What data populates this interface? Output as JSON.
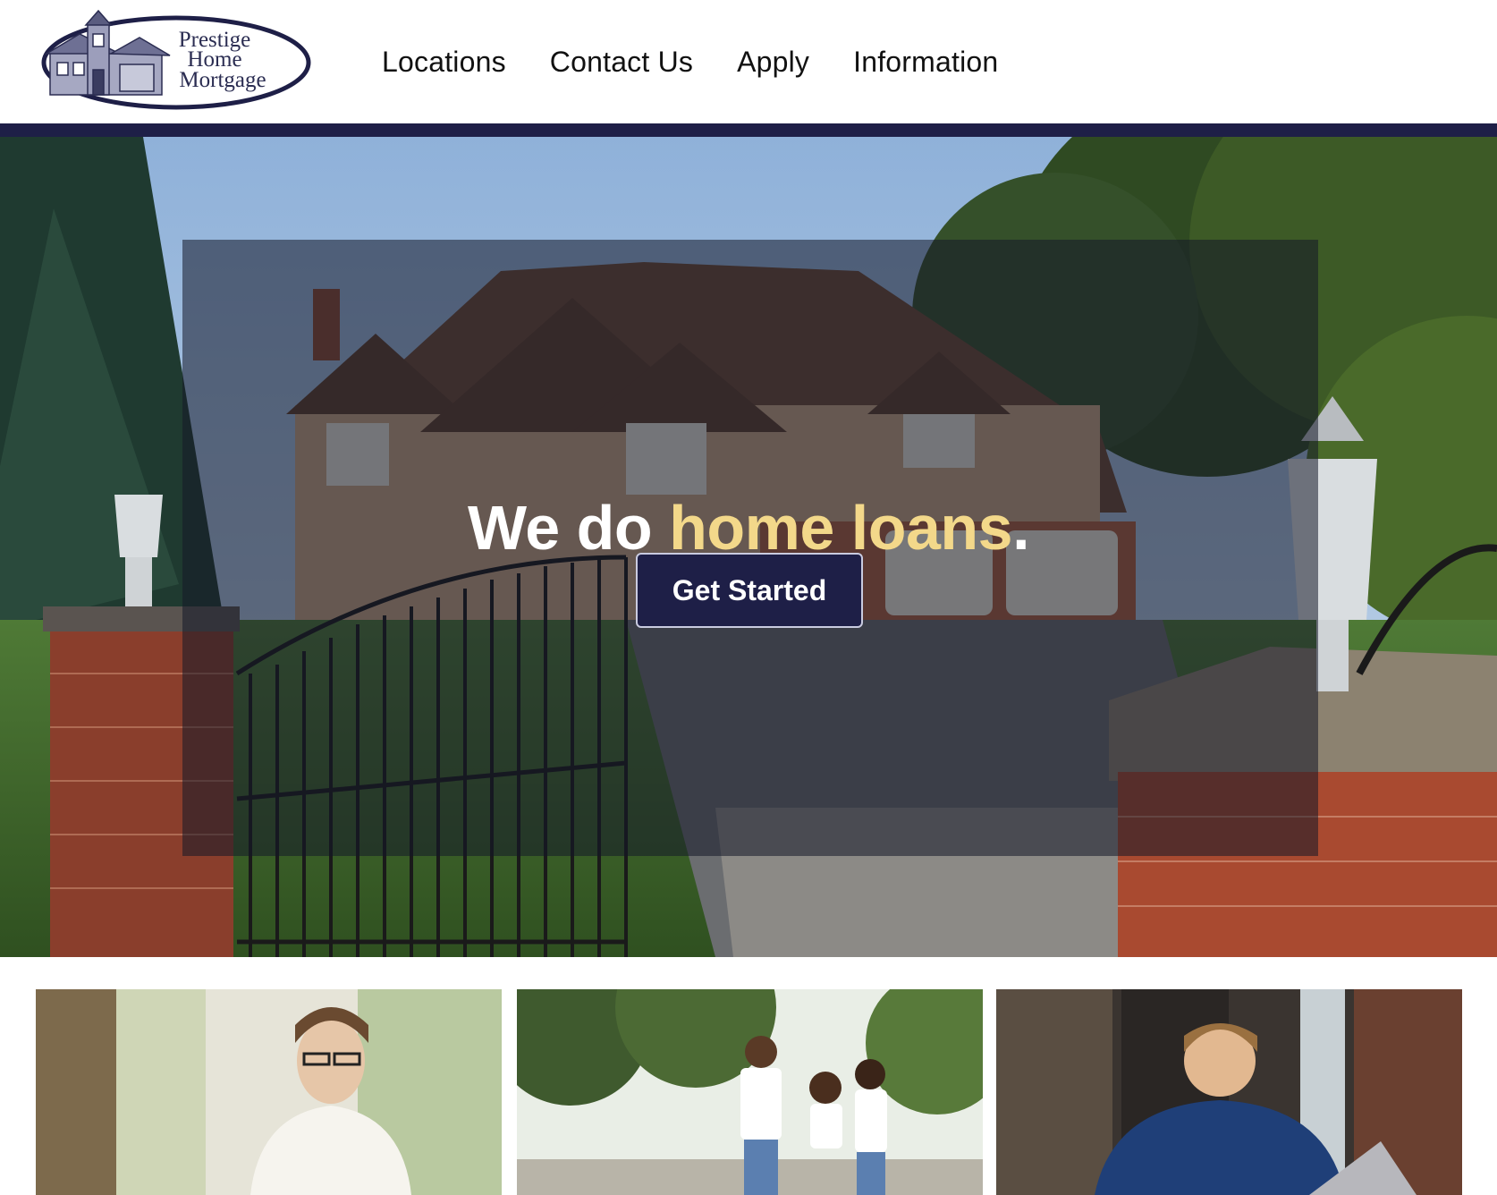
{
  "header": {
    "logo": {
      "lines": [
        "Prestige",
        "Home",
        "Mortgage"
      ],
      "icon": "house-logo-icon"
    },
    "nav": [
      {
        "label": "Locations"
      },
      {
        "label": "Contact Us"
      },
      {
        "label": "Apply"
      },
      {
        "label": "Information"
      }
    ]
  },
  "hero": {
    "headline_prefix": "We do ",
    "headline_accent": "home loans",
    "headline_suffix": ".",
    "cta_label": "Get Started",
    "image": "house-with-gate-photo"
  },
  "cards": [
    {
      "image": "woman-with-laptop-photo"
    },
    {
      "image": "family-bike-ride-photo"
    },
    {
      "image": "man-with-laptop-photo"
    }
  ],
  "colors": {
    "brand_navy": "#1e1f47",
    "accent_gold": "#f3d88a",
    "nav_text": "#111111"
  }
}
